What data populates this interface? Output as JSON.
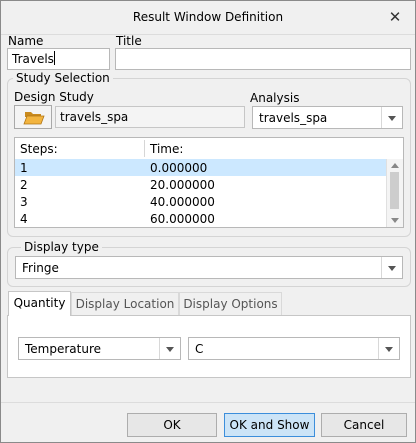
{
  "window": {
    "title": "Result Window Definition",
    "close_glyph": "✕"
  },
  "name": {
    "label": "Name",
    "value": "Travels"
  },
  "title_field": {
    "label": "Title",
    "value": ""
  },
  "study_selection": {
    "group_label": "Study Selection",
    "design_study_label": "Design Study",
    "design_study_value": "travels_spa",
    "analysis_label": "Analysis",
    "analysis_value": "travels_spa",
    "folder_icon": "folder-open-icon"
  },
  "steps_table": {
    "headers": [
      "Steps:",
      "Time:"
    ],
    "rows": [
      {
        "step": "1",
        "time": "0.000000",
        "selected": true
      },
      {
        "step": "2",
        "time": "20.000000",
        "selected": false
      },
      {
        "step": "3",
        "time": "40.000000",
        "selected": false
      },
      {
        "step": "4",
        "time": "60.000000",
        "selected": false
      }
    ]
  },
  "display_type": {
    "group_label": "Display type",
    "value": "Fringe"
  },
  "tabs": [
    {
      "label": "Quantity",
      "active": true
    },
    {
      "label": "Display Location",
      "active": false
    },
    {
      "label": "Display Options",
      "active": false
    }
  ],
  "quantity": {
    "quantity_value": "Temperature",
    "unit_value": "C"
  },
  "buttons": {
    "ok": "OK",
    "ok_and_show": "OK and Show",
    "cancel": "Cancel"
  },
  "colors": {
    "selection": "#cce8ff",
    "primary_button": "#cce4f7",
    "primary_border": "#3c8edb",
    "folder": "#e8a93b"
  }
}
